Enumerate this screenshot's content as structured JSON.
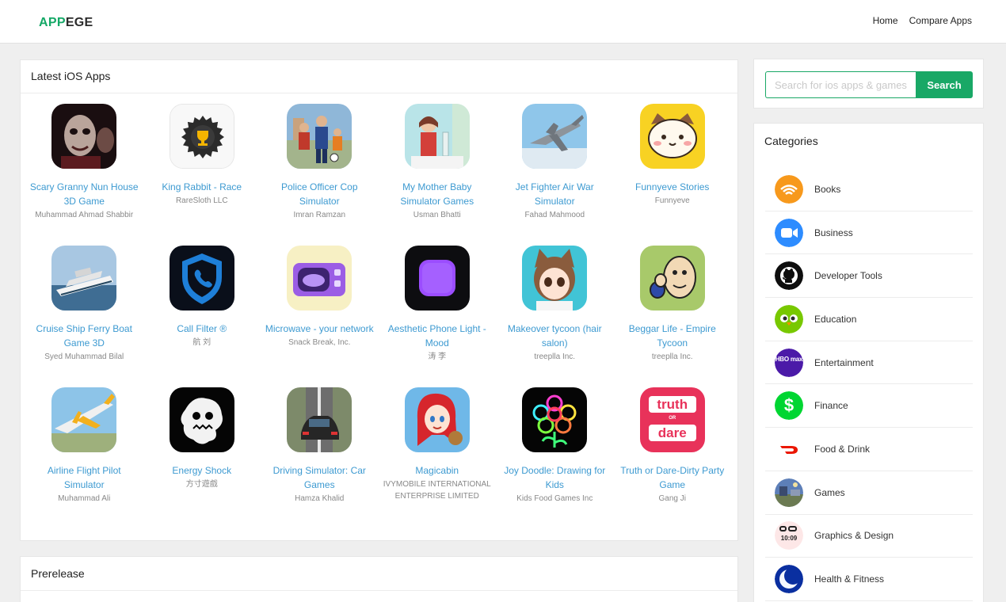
{
  "brand": {
    "logo_part1": "APP",
    "logo_part2": "EGE"
  },
  "nav": {
    "home": "Home",
    "compare": "Compare Apps"
  },
  "latest": {
    "title": "Latest iOS Apps",
    "apps": [
      {
        "name": "Scary Granny Nun House 3D Game",
        "dev": "Muhammad Ahmad Shabbir",
        "icon": "granny-icon"
      },
      {
        "name": "King Rabbit - Race",
        "dev": "RareSloth LLC",
        "icon": "saw-trophy-icon"
      },
      {
        "name": "Police Officer Cop Simulator",
        "dev": "Imran Ramzan",
        "icon": "police-family-icon"
      },
      {
        "name": "My Mother Baby Simulator Games",
        "dev": "Usman Bhatti",
        "icon": "mother-icon"
      },
      {
        "name": "Jet Fighter Air War Simulator",
        "dev": "Fahad Mahmood",
        "icon": "jet-icon"
      },
      {
        "name": "Funnyeve Stories",
        "dev": "Funnyeve",
        "icon": "cat-face-icon"
      },
      {
        "name": "Cruise Ship Ferry Boat Game 3D",
        "dev": "Syed Muhammad Bilal",
        "icon": "ship-icon"
      },
      {
        "name": "Call Filter ®",
        "dev": "航 刘",
        "icon": "shield-phone-icon"
      },
      {
        "name": "Microwave - your network",
        "dev": "Snack Break, Inc.",
        "icon": "microwave-icon"
      },
      {
        "name": "Aesthetic Phone Light - Mood",
        "dev": "涛 李",
        "icon": "purple-square-icon"
      },
      {
        "name": "Makeover tycoon (hair salon)",
        "dev": "treeplla Inc.",
        "icon": "cat-girl-icon"
      },
      {
        "name": "Beggar Life - Empire Tycoon",
        "dev": "treeplla Inc.",
        "icon": "beggar-icon"
      },
      {
        "name": "Airline Flight Pilot Simulator",
        "dev": "Muhammad Ali",
        "icon": "airplane-icon"
      },
      {
        "name": "Energy Shock",
        "dev": "方寸遊戲",
        "icon": "shock-icon"
      },
      {
        "name": "Driving Simulator: Car Games",
        "dev": "Hamza Khalid",
        "icon": "car-icon"
      },
      {
        "name": "Magicabin",
        "dev": "IVYMOBILE INTERNATIONAL ENTERPRISE LIMITED",
        "icon": "redhead-girl-icon"
      },
      {
        "name": "Joy Doodle: Drawing for Kids",
        "dev": "Kids Food Games Inc",
        "icon": "neon-flower-icon"
      },
      {
        "name": "Truth or Dare-Dirty Party Game",
        "dev": "Gang Ji",
        "icon": "truth-dare-icon",
        "icon_text": {
          "top": "truth",
          "mid": "OR",
          "bottom": "dare"
        }
      }
    ]
  },
  "prerelease": {
    "title": "Prerelease"
  },
  "search": {
    "placeholder": "Search for ios apps & games",
    "button": "Search"
  },
  "categories": {
    "title": "Categories",
    "items": [
      {
        "label": "Books",
        "icon": "audible-icon"
      },
      {
        "label": "Business",
        "icon": "zoom-camera-icon"
      },
      {
        "label": "Developer Tools",
        "icon": "github-icon"
      },
      {
        "label": "Education",
        "icon": "duolingo-owl-icon"
      },
      {
        "label": "Entertainment",
        "icon": "hbo-max-icon",
        "icon_text": "HBO max"
      },
      {
        "label": "Finance",
        "icon": "cash-dollar-icon",
        "icon_text": "$"
      },
      {
        "label": "Food & Drink",
        "icon": "doordash-icon"
      },
      {
        "label": "Games",
        "icon": "games-scene-icon"
      },
      {
        "label": "Graphics & Design",
        "icon": "widget-clock-icon",
        "icon_text": "10:09"
      },
      {
        "label": "Health & Fitness",
        "icon": "moon-icon"
      }
    ]
  },
  "colors": {
    "accent": "#19a866",
    "link": "#3d9ad1"
  }
}
